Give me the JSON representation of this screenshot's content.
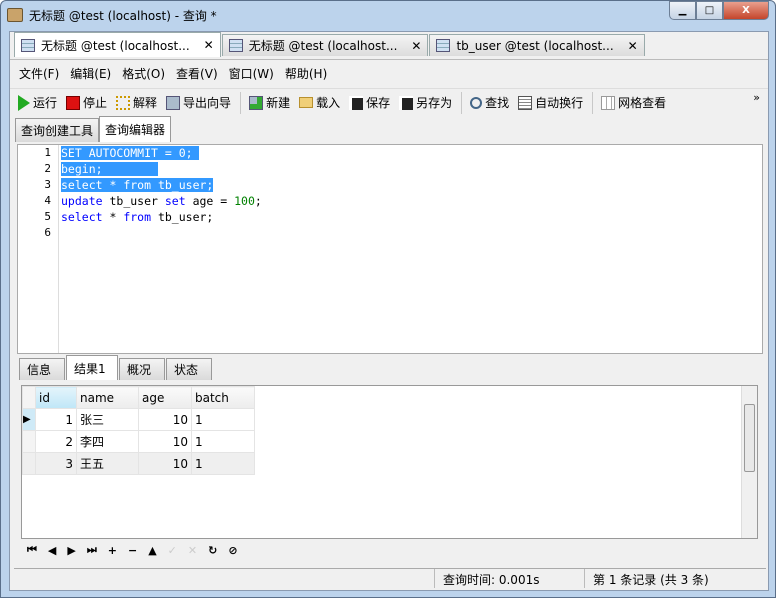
{
  "window": {
    "title": "无标题 @test (localhost) - 查询 *",
    "min": "▁",
    "max": "□",
    "close": "X"
  },
  "doc_tabs": [
    {
      "label": "无标题 @test (localhost..."
    },
    {
      "label": "无标题 @test (localhost..."
    },
    {
      "label": "tb_user @test (localhost..."
    }
  ],
  "menu": [
    "文件(F)",
    "编辑(E)",
    "格式(O)",
    "查看(V)",
    "窗口(W)",
    "帮助(H)"
  ],
  "toolbar": [
    {
      "label": "运行",
      "icon": "play-icon"
    },
    {
      "label": "停止",
      "icon": "stop-icon"
    },
    {
      "label": "解释",
      "icon": "explain-icon"
    },
    {
      "label": "导出向导",
      "icon": "export-icon"
    },
    {
      "label": "新建",
      "icon": "new-icon"
    },
    {
      "label": "载入",
      "icon": "folder-icon"
    },
    {
      "label": "保存",
      "icon": "save-icon"
    },
    {
      "label": "另存为",
      "icon": "save-as-icon"
    },
    {
      "label": "查找",
      "icon": "search-icon"
    },
    {
      "label": "自动换行",
      "icon": "wrap-icon"
    },
    {
      "label": "网格查看",
      "icon": "grid-icon"
    }
  ],
  "toolbar_more": "»",
  "sub_tabs": [
    "查询创建工具",
    "查询编辑器"
  ],
  "editor": {
    "line_numbers": [
      "1",
      "2",
      "3",
      "4",
      "5",
      "6"
    ],
    "selection_color": "#3399ff"
  },
  "result_tabs": [
    "信息",
    "结果1",
    "概况",
    "状态"
  ],
  "grid": {
    "columns": [
      "id",
      "name",
      "age",
      "batch"
    ],
    "rows": [
      [
        "1",
        "张三",
        "10",
        "1"
      ],
      [
        "2",
        "李四",
        "10",
        "1"
      ],
      [
        "3",
        "王五",
        "10",
        "1"
      ]
    ]
  },
  "nav": [
    "⏮",
    "◀",
    "▶",
    "⏭",
    "+",
    "−",
    "▲",
    "✓",
    "✕",
    "↻",
    "⊘"
  ],
  "status": {
    "query_time": "查询时间: 0.001s",
    "record": "第 1 条记录 (共 3 条)"
  }
}
